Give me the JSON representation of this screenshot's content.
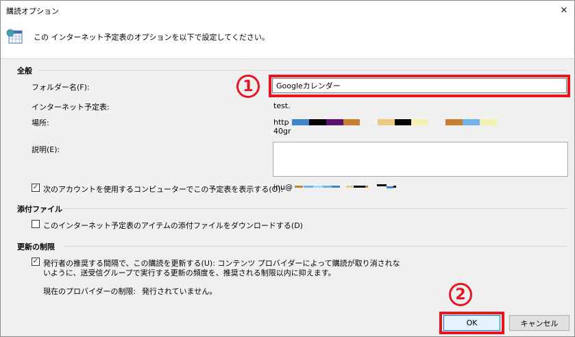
{
  "window": {
    "title": "購読オプション",
    "close_glyph": "✕"
  },
  "header": {
    "icon": "calendar-globe-icon",
    "text": "この インターネット予定表のオプションを以下で設定してください。"
  },
  "general": {
    "section_title": "全般",
    "folder_label": "フォルダー名(F):",
    "folder_value": "Googleカレンダー",
    "calendar_label": "インターネット予定表:",
    "calendar_value": "test.",
    "location_label": "場所:",
    "location_prefix": "http",
    "location_suffix": "40gr",
    "description_label": "説明(E):",
    "description_value": "",
    "show_calendar_checkbox_label": "次のアカウントを使用するコンピューターでこの予定表を表示する(O):",
    "show_calendar_checked": true,
    "account_prefix": "inu@"
  },
  "attachments": {
    "section_title": "添付ファイル",
    "download_label": "このインターネット予定表のアイテムの添付ファイルをダウンロードする(D)",
    "download_checked": false
  },
  "update_limit": {
    "section_title": "更新の制限",
    "publisher_label_line1": "発行者の推奨する間隔で、この購読を更新する(U): コンテンツ プロバイダーによって購読が取り消されな",
    "publisher_label_line2": "いように、送受信グループで実行する更新の頻度を、推奨される制限以内に抑えます。",
    "publisher_checked": true,
    "provider_limit_label": "現在のプロバイダーの制限:",
    "provider_limit_value": "発行されていません。"
  },
  "buttons": {
    "ok": "OK",
    "cancel": "キャンセル"
  },
  "annotations": {
    "step1": "1",
    "step2": "2"
  },
  "colors": {
    "annotation_red": "#e8141e",
    "ok_border": "#0078d7"
  }
}
